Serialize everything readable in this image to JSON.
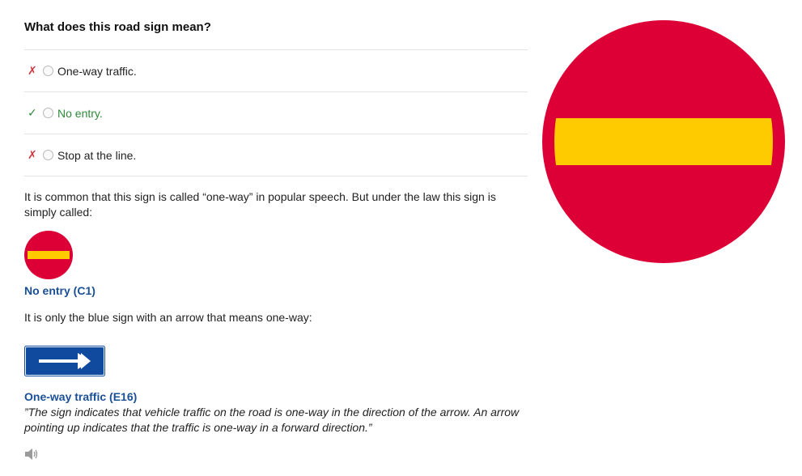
{
  "question": {
    "title": "What does this road sign mean?"
  },
  "options": [
    {
      "label": "One-way traffic.",
      "mark": "✗",
      "status": "wrong"
    },
    {
      "label": "No entry.",
      "mark": "✓",
      "status": "correct"
    },
    {
      "label": "Stop at the line.",
      "mark": "✗",
      "status": "wrong"
    }
  ],
  "explanation": {
    "paragraph1": "It is common that this sign is called “one-way” in popular speech. But under the law this sign is simply called:",
    "sign1_caption": "No entry (C1)",
    "paragraph2": "It is only the blue sign with an arrow that means one-way:",
    "sign2_caption": "One-way traffic (E16)",
    "quote": "”The sign indicates that vehicle traffic on the road is one-way in the direction of the arrow. An arrow pointing up indicates that the traffic is one-way in a forward direction.”"
  },
  "icons": {
    "audio": "speaker-icon",
    "sign_no_entry": "no-entry-sign",
    "sign_one_way": "one-way-sign"
  },
  "colors": {
    "sign_red": "#dc0036",
    "sign_yellow": "#fdcb00",
    "sign_blue": "#0f4a9e",
    "correct": "#2e8a3a",
    "wrong": "#d0363f",
    "caption_blue": "#1a4f96"
  }
}
